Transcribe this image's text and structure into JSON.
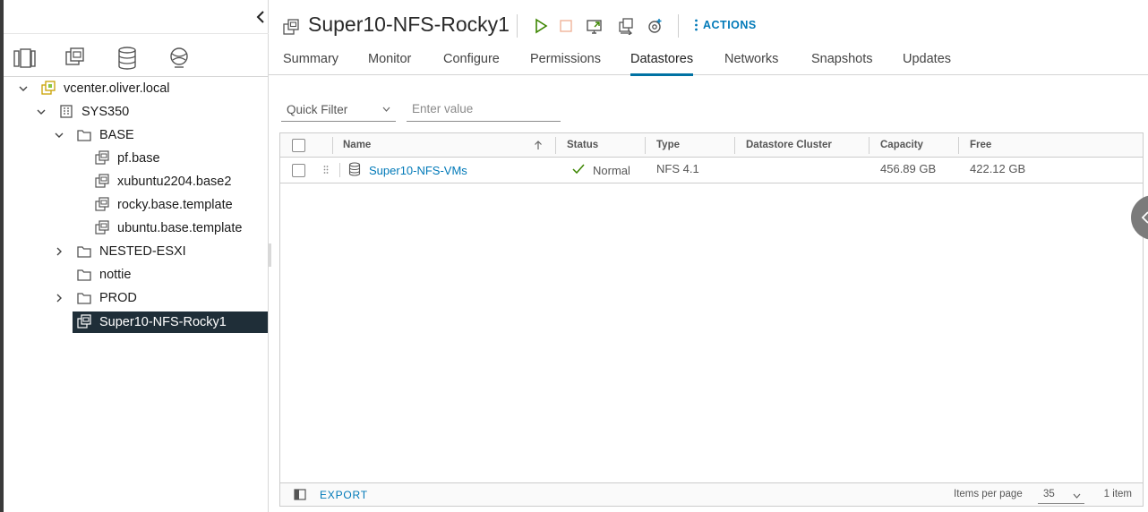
{
  "navigator": {
    "tabs": [
      "hosts-clusters",
      "vms-templates",
      "storage",
      "networking"
    ],
    "active_tab": "vms-templates",
    "tree": {
      "vcenter": "vcenter.oliver.local",
      "datacenter": "SYS350",
      "base_folder": "BASE",
      "base_items": [
        "pf.base",
        "xubuntu2204.base2",
        "rocky.base.template",
        "ubuntu.base.template"
      ],
      "nested_folder": "NESTED-ESXI",
      "nottie_folder": "nottie",
      "prod_folder": "PROD",
      "selected_vm": "Super10-NFS-Rocky1"
    }
  },
  "header": {
    "title": "Super10-NFS-Rocky1",
    "actions_label": "ACTIONS"
  },
  "tabs": [
    "Summary",
    "Monitor",
    "Configure",
    "Permissions",
    "Datastores",
    "Networks",
    "Snapshots",
    "Updates"
  ],
  "active_tab": "Datastores",
  "filter": {
    "select_label": "Quick Filter",
    "input_placeholder": "Enter value"
  },
  "grid": {
    "columns": [
      "Name",
      "Status",
      "Type",
      "Datastore Cluster",
      "Capacity",
      "Free"
    ],
    "sort_column": "Name",
    "rows": [
      {
        "name": "Super10-NFS-VMs",
        "status": "Normal",
        "type": "NFS 4.1",
        "cluster": "",
        "capacity": "456.89 GB",
        "free": "422.12 GB"
      }
    ],
    "footer": {
      "export_label": "EXPORT",
      "items_per_page_label": "Items per page",
      "items_per_page": "35",
      "count": "1 item"
    }
  },
  "colors": {
    "accent": "#0072a3",
    "link": "#0079b8",
    "selected_bg": "#1f2e38",
    "status_ok": "#3c8500",
    "run_green": "#3c8500",
    "stop_orange": "#f0b49a"
  }
}
